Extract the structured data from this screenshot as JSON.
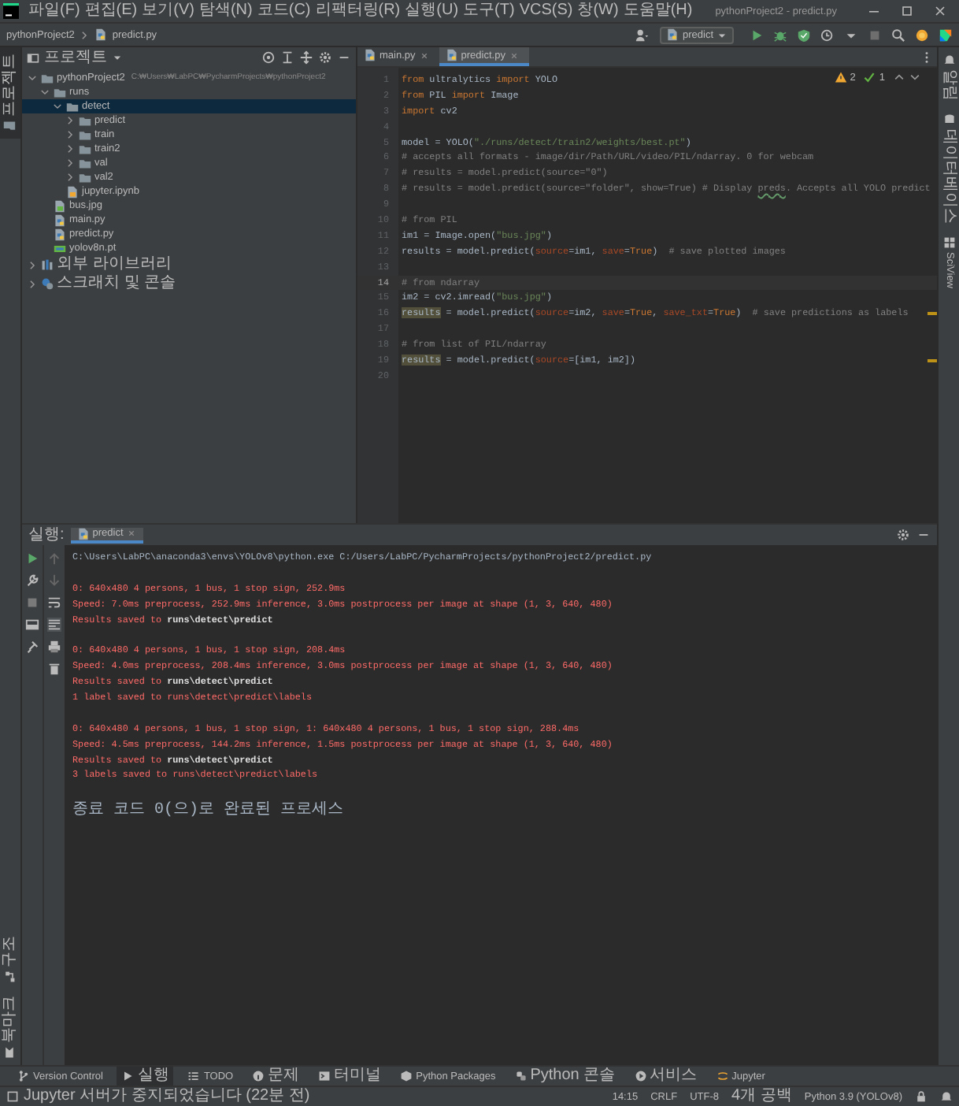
{
  "window": {
    "title": "pythonProject2 - predict.py"
  },
  "menu": [
    "파일(F)",
    "편집(E)",
    "보기(V)",
    "탐색(N)",
    "코드(C)",
    "리팩터링(R)",
    "실행(U)",
    "도구(T)",
    "VCS(S)",
    "창(W)",
    "도움말(H)"
  ],
  "breadcrumb": [
    "pythonProject2",
    "predict.py"
  ],
  "run_config": {
    "label": "predict"
  },
  "left_strip": {
    "top": [
      {
        "label": "프로젝트",
        "selected": true
      }
    ],
    "bottom": [
      {
        "label": "구조",
        "selected": false
      },
      {
        "label": "북마크",
        "selected": false
      }
    ]
  },
  "right_strip": [
    {
      "label": "알림",
      "selected": false
    },
    {
      "label": "데이터베이스",
      "selected": false
    },
    {
      "label": "SciView",
      "selected": false
    }
  ],
  "project_panel": {
    "title": "프로젝트",
    "tree": [
      {
        "label": "pythonProject2",
        "kind": "folder",
        "path": "C:₩Users₩LabPC₩PycharmProjects₩pythonProject2",
        "expanded": true,
        "selected": false,
        "children": [
          {
            "label": "runs",
            "kind": "folder",
            "expanded": true,
            "selected": false,
            "children": [
              {
                "label": "detect",
                "kind": "folder",
                "expanded": true,
                "selected": true,
                "children": [
                  {
                    "label": "predict",
                    "kind": "folder",
                    "expanded": false,
                    "selected": false
                  },
                  {
                    "label": "train",
                    "kind": "folder",
                    "expanded": false,
                    "selected": false
                  },
                  {
                    "label": "train2",
                    "kind": "folder",
                    "expanded": false,
                    "selected": false
                  },
                  {
                    "label": "val",
                    "kind": "folder",
                    "expanded": false,
                    "selected": false
                  },
                  {
                    "label": "val2",
                    "kind": "folder",
                    "expanded": false,
                    "selected": false
                  }
                ]
              },
              {
                "label": "jupyter.ipynb",
                "kind": "notebook",
                "selected": false
              }
            ]
          },
          {
            "label": "bus.jpg",
            "kind": "image",
            "selected": false
          },
          {
            "label": "main.py",
            "kind": "python",
            "selected": false
          },
          {
            "label": "predict.py",
            "kind": "python",
            "selected": false
          },
          {
            "label": "yolov8n.pt",
            "kind": "model",
            "selected": false
          }
        ]
      },
      {
        "label": "외부 라이브러리",
        "kind": "library",
        "expanded": false,
        "selected": false
      },
      {
        "label": "스크래치 및 콘솔",
        "kind": "scratch",
        "expanded": false,
        "selected": false
      }
    ]
  },
  "editor": {
    "tabs": [
      {
        "label": "main.py",
        "selected": false
      },
      {
        "label": "predict.py",
        "selected": true
      }
    ],
    "inspections": {
      "warnings": "2",
      "weak_warnings": "1"
    },
    "lines": [
      {
        "number": "1",
        "current": false,
        "marked": false,
        "segments": [
          {
            "kind": "kw",
            "text": "from"
          },
          {
            "kind": "plain",
            "text": " ultralytics "
          },
          {
            "kind": "kw",
            "text": "import"
          },
          {
            "kind": "plain",
            "text": " YOLO"
          }
        ]
      },
      {
        "number": "2",
        "current": false,
        "marked": false,
        "segments": [
          {
            "kind": "kw",
            "text": "from"
          },
          {
            "kind": "plain",
            "text": " PIL "
          },
          {
            "kind": "kw",
            "text": "import"
          },
          {
            "kind": "plain",
            "text": " Image"
          }
        ]
      },
      {
        "number": "3",
        "current": false,
        "marked": false,
        "segments": [
          {
            "kind": "kw",
            "text": "import"
          },
          {
            "kind": "plain",
            "text": " cv2"
          }
        ]
      },
      {
        "number": "4",
        "current": false,
        "marked": false
      },
      {
        "number": "5",
        "current": false,
        "marked": false,
        "segments": [
          {
            "kind": "plain",
            "text": "model = YOLO("
          },
          {
            "kind": "str",
            "text": "\"./runs/detect/train2/weights/best.pt\""
          },
          {
            "kind": "plain",
            "text": ")"
          }
        ]
      },
      {
        "number": "6",
        "current": false,
        "marked": false,
        "segments": [
          {
            "kind": "cmt",
            "text": "# accepts all formats - image/dir/Path/URL/video/PIL/ndarray. 0 for webcam"
          }
        ]
      },
      {
        "number": "7",
        "current": false,
        "marked": false,
        "segments": [
          {
            "kind": "cmt",
            "text": "# results = model.predict(source=\"0\")"
          }
        ]
      },
      {
        "number": "8",
        "current": false,
        "marked": false,
        "segments": [
          {
            "kind": "cmt",
            "text": "# results = model.predict(source=\"folder\", show=True) # Display "
          },
          {
            "kind": "typo",
            "text": "preds"
          },
          {
            "kind": "cmt",
            "text": ". Accepts all YOLO predict"
          }
        ]
      },
      {
        "number": "9",
        "current": false,
        "marked": false
      },
      {
        "number": "10",
        "current": false,
        "marked": false,
        "segments": [
          {
            "kind": "cmt",
            "text": "# from PIL"
          }
        ]
      },
      {
        "number": "11",
        "current": false,
        "marked": false,
        "segments": [
          {
            "kind": "plain",
            "text": "im1 = Image.open("
          },
          {
            "kind": "str",
            "text": "\"bus.jpg\""
          },
          {
            "kind": "plain",
            "text": ")"
          }
        ]
      },
      {
        "number": "12",
        "current": false,
        "marked": false,
        "segments": [
          {
            "kind": "plain",
            "text": "results = model.predict("
          },
          {
            "kind": "param",
            "text": "source"
          },
          {
            "kind": "plain",
            "text": "=im1, "
          },
          {
            "kind": "param",
            "text": "save"
          },
          {
            "kind": "plain",
            "text": "="
          },
          {
            "kind": "kw",
            "text": "True"
          },
          {
            "kind": "plain",
            "text": ")  "
          },
          {
            "kind": "cmt",
            "text": "# save plotted images"
          }
        ]
      },
      {
        "number": "13",
        "current": false,
        "marked": false
      },
      {
        "number": "14",
        "current": true,
        "marked": false,
        "segments": [
          {
            "kind": "cmt",
            "text": "# from ndarray"
          }
        ]
      },
      {
        "number": "15",
        "current": false,
        "marked": false,
        "segments": [
          {
            "kind": "plain",
            "text": "im2 = cv2.imread("
          },
          {
            "kind": "str",
            "text": "\"bus.jpg\""
          },
          {
            "kind": "plain",
            "text": ")"
          }
        ]
      },
      {
        "number": "16",
        "current": false,
        "marked": true,
        "segments": [
          {
            "kind": "usage",
            "text": "results"
          },
          {
            "kind": "plain",
            "text": " = model.predict("
          },
          {
            "kind": "param",
            "text": "source"
          },
          {
            "kind": "plain",
            "text": "=im2, "
          },
          {
            "kind": "param",
            "text": "save"
          },
          {
            "kind": "plain",
            "text": "="
          },
          {
            "kind": "kw",
            "text": "True"
          },
          {
            "kind": "plain",
            "text": ", "
          },
          {
            "kind": "param",
            "text": "save_txt"
          },
          {
            "kind": "plain",
            "text": "="
          },
          {
            "kind": "kw",
            "text": "True"
          },
          {
            "kind": "plain",
            "text": ")  "
          },
          {
            "kind": "cmt",
            "text": "# save predictions as labels"
          }
        ]
      },
      {
        "number": "17",
        "current": false,
        "marked": false
      },
      {
        "number": "18",
        "current": false,
        "marked": false,
        "segments": [
          {
            "kind": "cmt",
            "text": "# from list of PIL/ndarray"
          }
        ]
      },
      {
        "number": "19",
        "current": false,
        "marked": true,
        "segments": [
          {
            "kind": "usage",
            "text": "results"
          },
          {
            "kind": "plain",
            "text": " = model.predict("
          },
          {
            "kind": "param",
            "text": "source"
          },
          {
            "kind": "plain",
            "text": "=[im1, im2])"
          }
        ]
      },
      {
        "number": "20",
        "current": false,
        "marked": false
      }
    ]
  },
  "run_panel": {
    "label": "실행:",
    "tabs": [
      {
        "label": "predict",
        "selected": true
      }
    ],
    "output": [
      {
        "kind": "command",
        "text": "C:\\Users\\LabPC\\anaconda3\\envs\\YOLOv8\\python.exe C:/Users/LabPC/PycharmProjects/pythonProject2/predict.py"
      },
      {
        "kind": "blank"
      },
      {
        "kind": "error",
        "text": "0: 640x480 4 persons, 1 bus, 1 stop sign, 252.9ms"
      },
      {
        "kind": "error",
        "text": "Speed: 7.0ms preprocess, 252.9ms inference, 3.0ms postprocess per image at shape (1, 3, 640, 480)"
      },
      {
        "kind": "error",
        "text": "Results saved to **runs\\detect\\predict**"
      },
      {
        "kind": "blank"
      },
      {
        "kind": "error",
        "text": "0: 640x480 4 persons, 1 bus, 1 stop sign, 208.4ms"
      },
      {
        "kind": "error",
        "text": "Speed: 4.0ms preprocess, 208.4ms inference, 3.0ms postprocess per image at shape (1, 3, 640, 480)"
      },
      {
        "kind": "error",
        "text": "Results saved to **runs\\detect\\predict**"
      },
      {
        "kind": "error",
        "text": "1 label saved to runs\\detect\\predict\\labels"
      },
      {
        "kind": "blank"
      },
      {
        "kind": "error",
        "text": "0: 640x480 4 persons, 1 bus, 1 stop sign, 1: 640x480 4 persons, 1 bus, 1 stop sign, 288.4ms"
      },
      {
        "kind": "error",
        "text": "Speed: 4.5ms preprocess, 144.2ms inference, 1.5ms postprocess per image at shape (1, 3, 640, 480)"
      },
      {
        "kind": "error",
        "text": "Results saved to **runs\\detect\\predict**"
      },
      {
        "kind": "error",
        "text": "3 labels saved to runs\\detect\\predict\\labels"
      },
      {
        "kind": "blank"
      },
      {
        "kind": "exit",
        "text": "종료 코드 0(으)로 완료된 프로세스"
      }
    ]
  },
  "tool_windows": [
    {
      "label": "Version Control",
      "selected": false
    },
    {
      "label": "실행",
      "selected": true
    },
    {
      "label": "TODO",
      "selected": false
    },
    {
      "label": "문제",
      "selected": false
    },
    {
      "label": "터미널",
      "selected": false
    },
    {
      "label": "Python Packages",
      "selected": false
    },
    {
      "label": "Python 콘솔",
      "selected": false
    },
    {
      "label": "서비스",
      "selected": false
    },
    {
      "label": "Jupyter",
      "selected": false
    }
  ],
  "status_bar": {
    "message": "Jupyter 서버가 중지되었습니다 (22분 전)",
    "items": [
      "14:15",
      "CRLF",
      "UTF-8",
      "4개 공백",
      "Python 3.9 (YOLOv8)"
    ]
  }
}
